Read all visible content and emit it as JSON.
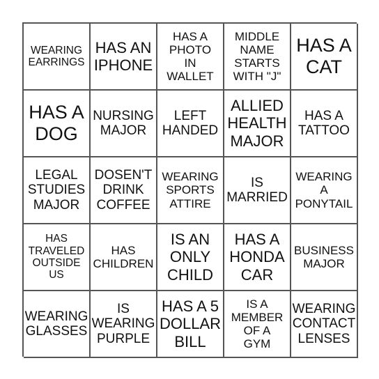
{
  "board": {
    "cells": [
      {
        "text": "WEARING\nEARRINGS",
        "size": "s1"
      },
      {
        "text": "HAS AN\nIPHONE",
        "size": "s4"
      },
      {
        "text": "HAS A\nPHOTO\nIN\nWALLET",
        "size": "s2"
      },
      {
        "text": "MIDDLE\nNAME\nSTARTS\nWITH \"J\"",
        "size": "s2"
      },
      {
        "text": "HAS A\nCAT",
        "size": "s5"
      },
      {
        "text": "HAS A\nDOG",
        "size": "s5"
      },
      {
        "text": "NURSING\nMAJOR",
        "size": "s3"
      },
      {
        "text": "LEFT\nHANDED",
        "size": "s3"
      },
      {
        "text": "ALLIED\nHEALTH\nMAJOR",
        "size": "s4"
      },
      {
        "text": "HAS A\nTATTOO",
        "size": "s3"
      },
      {
        "text": "LEGAL\nSTUDIES\nMAJOR",
        "size": "s3"
      },
      {
        "text": "DOSEN'T\nDRINK\nCOFFEE",
        "size": "s3"
      },
      {
        "text": "WEARING\nSPORTS\nATTIRE",
        "size": "s2"
      },
      {
        "text": "IS\nMARRIED",
        "size": "s3"
      },
      {
        "text": "WEARING\nA\nPONYTAIL",
        "size": "s2"
      },
      {
        "text": "HAS\nTRAVELED\nOUTSIDE\nUS",
        "size": "s1"
      },
      {
        "text": "HAS\nCHILDREN",
        "size": "s2"
      },
      {
        "text": "IS AN\nONLY\nCHILD",
        "size": "s4"
      },
      {
        "text": "HAS A\nHONDA\nCAR",
        "size": "s4"
      },
      {
        "text": "BUSINESS\nMAJOR",
        "size": "s2"
      },
      {
        "text": "WEARING\nGLASSES",
        "size": "s3"
      },
      {
        "text": "IS\nWEARING\nPURPLE",
        "size": "s3"
      },
      {
        "text": "HAS A 5\nDOLLAR\nBILL",
        "size": "s4"
      },
      {
        "text": "IS A\nMEMBER\nOF A\nGYM",
        "size": "s2"
      },
      {
        "text": "WEARING\nCONTACT\nLENSES",
        "size": "s3"
      }
    ]
  }
}
